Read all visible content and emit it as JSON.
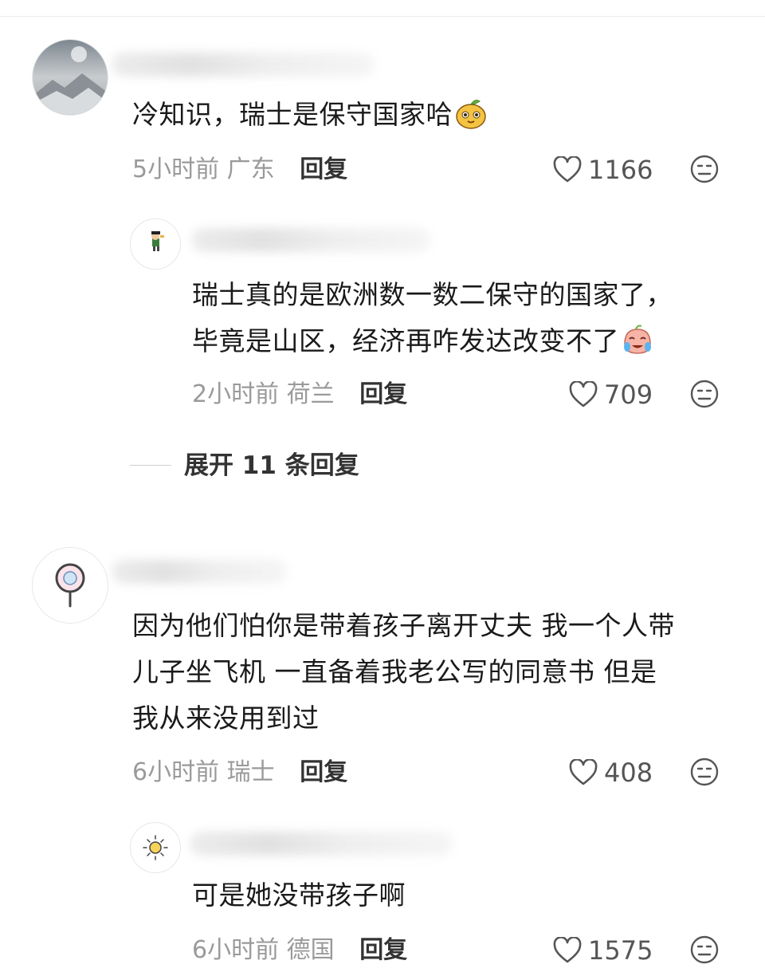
{
  "comments": [
    {
      "text": "冷知识，瑞士是保守国家哈",
      "time": "5小时前",
      "location": "广东",
      "reply_label": "回复",
      "likes": "1166",
      "replies": [
        {
          "text_line1": "瑞士真的是欧洲数一数二保守的国家了，",
          "text_line2": "毕竟是山区，经济再咋发达改变不了",
          "time": "2小时前",
          "location": "荷兰",
          "reply_label": "回复",
          "likes": "709"
        }
      ],
      "expand_label": "展开 11 条回复"
    },
    {
      "text_line1": "因为他们怕你是带着孩子离开丈夫 我一个人带",
      "text_line2": "儿子坐飞机 一直备着我老公写的同意书 但是",
      "text_line3": "我从来没用到过",
      "time": "6小时前",
      "location": "瑞士",
      "reply_label": "回复",
      "likes": "408",
      "replies": [
        {
          "text": "可是她没带孩子啊",
          "time": "6小时前",
          "location": "德国",
          "reply_label": "回复",
          "likes": "1575"
        }
      ]
    }
  ],
  "icons": {
    "like": "heart-outline-icon",
    "dislike": "meh-face-icon",
    "emoji1": "pear-emoji-icon",
    "emoji2": "crying-laugh-emoji-icon"
  },
  "colors": {
    "text": "#1a1a1a",
    "meta": "#9a9a9a",
    "reply": "#333333"
  }
}
